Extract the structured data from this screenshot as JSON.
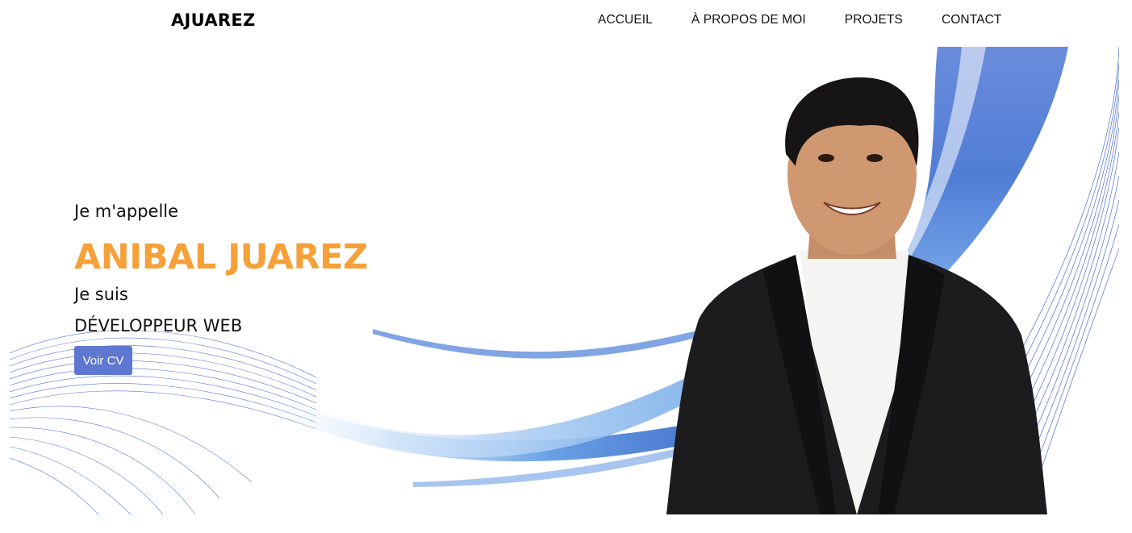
{
  "navbar": {
    "brand": "AJUAREZ",
    "links": [
      {
        "label": "ACCUEIL"
      },
      {
        "label": "À PROPOS DE MOI"
      },
      {
        "label": "PROJETS"
      },
      {
        "label": "CONTACT"
      }
    ]
  },
  "hero": {
    "intro": "Je m'appelle",
    "name": "ANIBAL JUAREZ",
    "iam": "Je suis",
    "role": "DÉVELOPPEUR WEB",
    "cv_button": "Voir CV"
  },
  "colors": {
    "accent_orange": "#f5a038",
    "button_blue": "#5e77d0",
    "wave_blue": "#3f6fd0"
  }
}
